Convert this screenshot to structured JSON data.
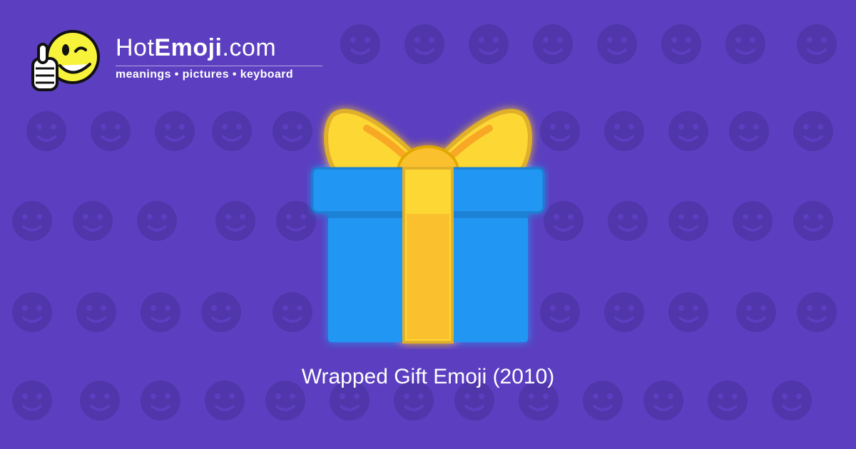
{
  "brand": {
    "name_prefix": "Hot",
    "name_bold": "Emoji",
    "name_suffix": ".com",
    "tagline": "meanings • pictures • keyboard"
  },
  "hero": {
    "emoji_icon": "wrapped-gift-icon",
    "caption": "Wrapped Gift Emoji (2010)"
  },
  "colors": {
    "background": "#5b3fc0",
    "pattern": "#4f36aa",
    "gift_box": "#2196f3",
    "ribbon": "#fdd835"
  }
}
